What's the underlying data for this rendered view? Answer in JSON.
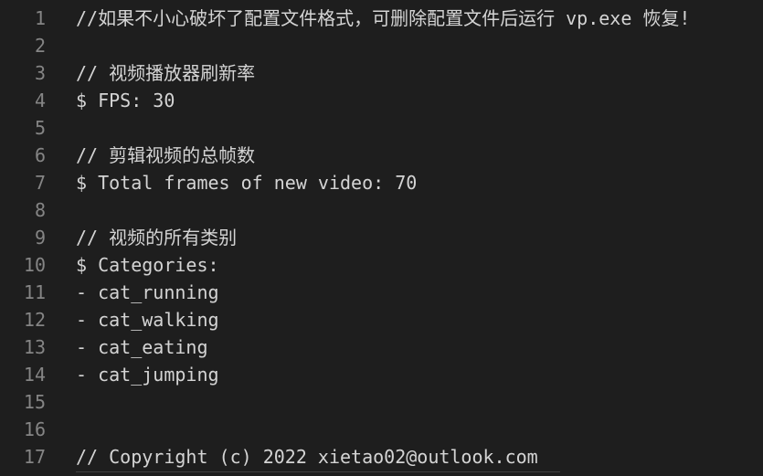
{
  "editor": {
    "lines": [
      {
        "n": "1",
        "text": "//如果不小心破坏了配置文件格式，可删除配置文件后运行 vp.exe 恢复!"
      },
      {
        "n": "2",
        "text": ""
      },
      {
        "n": "3",
        "text": "// 视频播放器刷新率"
      },
      {
        "n": "4",
        "text": "$ FPS: 30"
      },
      {
        "n": "5",
        "text": ""
      },
      {
        "n": "6",
        "text": "// 剪辑视频的总帧数"
      },
      {
        "n": "7",
        "text": "$ Total frames of new video: 70"
      },
      {
        "n": "8",
        "text": ""
      },
      {
        "n": "9",
        "text": "// 视频的所有类别"
      },
      {
        "n": "10",
        "text": "$ Categories:"
      },
      {
        "n": "11",
        "text": "- cat_running"
      },
      {
        "n": "12",
        "text": "- cat_walking"
      },
      {
        "n": "13",
        "text": "- cat_eating"
      },
      {
        "n": "14",
        "text": "- cat_jumping"
      },
      {
        "n": "15",
        "text": ""
      },
      {
        "n": "16",
        "text": ""
      },
      {
        "n": "17",
        "text": "// Copyright (c) 2022 xietao02@outlook.com"
      }
    ]
  },
  "colors": {
    "background": "#1e1e1e",
    "text": "#d4d4d4",
    "line_number": "#858585"
  }
}
